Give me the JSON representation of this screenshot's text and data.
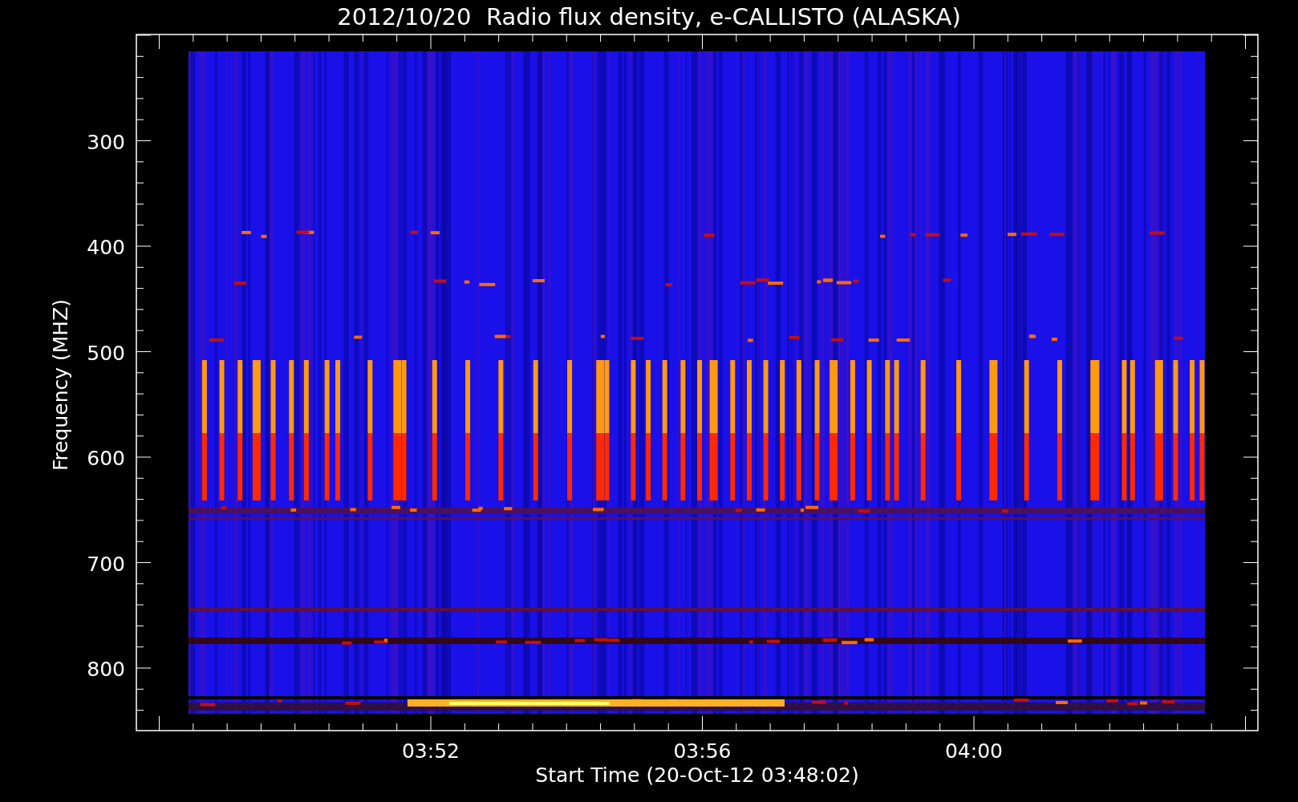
{
  "title": "2012/10/20  Radio flux density, e-CALLISTO (ALASKA)",
  "y_axis": {
    "label": "Frequency (MHZ)",
    "ticks": [
      "300",
      "400",
      "500",
      "600",
      "700",
      "800"
    ]
  },
  "x_axis": {
    "label": "Start Time (20-Oct-12 03:48:02)",
    "ticks": [
      "03:52",
      "03:56",
      "04:00"
    ]
  }
}
